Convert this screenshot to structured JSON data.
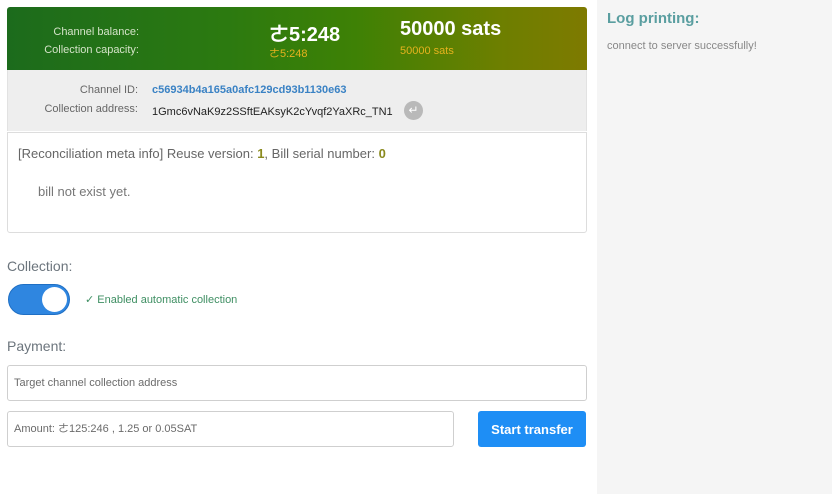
{
  "balance": {
    "balance_label": "Channel balance:",
    "capacity_label": "Collection capacity:",
    "balance_amount": "ㄜ5:248",
    "capacity_amount": "ㄜ5:248",
    "balance_sats": "50000 sats",
    "capacity_sats": "50000 sats"
  },
  "channel": {
    "id_label": "Channel ID:",
    "id_value": "c56934b4a165a0afc129cd93b1130e63",
    "address_label": "Collection address:",
    "address_value": "1Gmc6vNaK9z2SSftEAKsyK2cYvqf2YaXRc_TN1",
    "enter_icon": "↵"
  },
  "reconciliation": {
    "prefix": "[Reconciliation meta info] Reuse version: ",
    "reuse_version": "1",
    "middle": ", Bill serial number: ",
    "bill_serial": "0",
    "bill_status": "bill not exist yet."
  },
  "collection": {
    "title": "Collection:",
    "toggle_state": "on",
    "toggle_note": "✓ Enabled automatic collection"
  },
  "payment": {
    "title": "Payment:",
    "address_placeholder": "Target channel collection address",
    "amount_placeholder": "Amount: ㄜ125:246 , 1.25 or 0.05SAT",
    "submit_label": "Start transfer"
  },
  "log": {
    "title": "Log printing:",
    "entries": [
      "connect to server successfully!"
    ]
  },
  "colors": {
    "accent": "#1e8ef5",
    "gold": "#e6b21e",
    "log_title": "#5a9ea0"
  }
}
